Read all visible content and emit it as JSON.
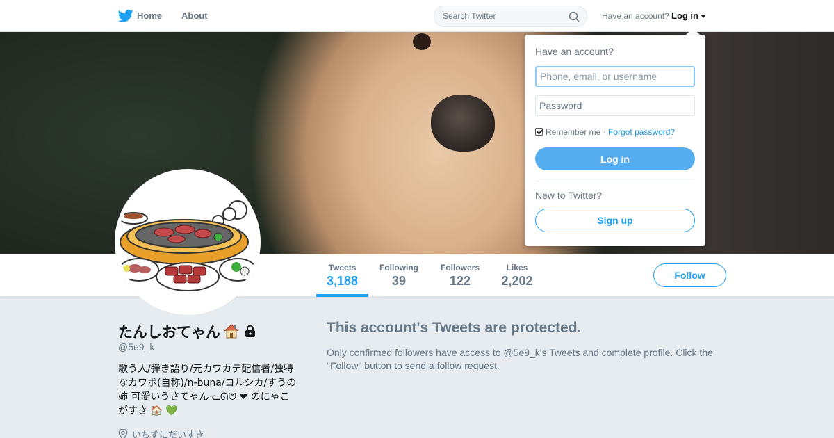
{
  "nav": {
    "home_label": "Home",
    "about_label": "About",
    "search_placeholder": "Search Twitter",
    "have_account": "Have an account?",
    "login_label": "Log in"
  },
  "profile": {
    "name": "たんしおてゃん",
    "handle": "@5e9_k",
    "bio": "歌う人/弾き語り/元カワカテ配信者/独特なカワボ(自称)/n-buna/ヨルシカ/すうの姉 可愛いうさてゃん ᓚᘏᗢ ❤ のにゃこがすき 🏠 💚",
    "location": "いちずにだいすき"
  },
  "stats": [
    {
      "label": "Tweets",
      "value": "3,188"
    },
    {
      "label": "Following",
      "value": "39"
    },
    {
      "label": "Followers",
      "value": "122"
    },
    {
      "label": "Likes",
      "value": "2,202"
    }
  ],
  "follow_label": "Follow",
  "protected": {
    "title": "This account's Tweets are protected.",
    "text": "Only confirmed followers have access to @5e9_k's Tweets and complete profile. Click the \"Follow\" button to send a follow request."
  },
  "login_dropdown": {
    "heading": "Have an account?",
    "username_placeholder": "Phone, email, or username",
    "password_placeholder": "Password",
    "remember_label": "Remember me",
    "separator": "·",
    "forgot_label": "Forgot password?",
    "login_button": "Log in",
    "new_label": "New to Twitter?",
    "signup_button": "Sign up"
  },
  "colors": {
    "brand_blue": "#1da1f2",
    "login_button": "#55acee",
    "text_secondary": "#657786",
    "background": "#e6ecf0"
  }
}
